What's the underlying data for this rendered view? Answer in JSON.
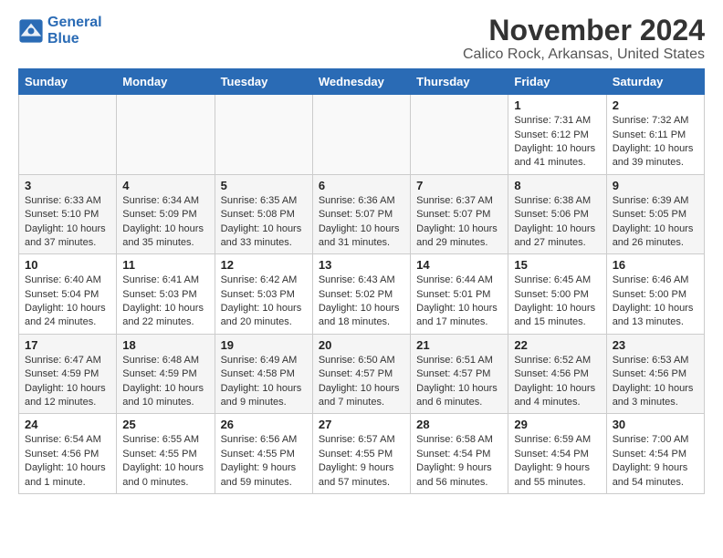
{
  "logo": {
    "line1": "General",
    "line2": "Blue"
  },
  "title": "November 2024",
  "subtitle": "Calico Rock, Arkansas, United States",
  "weekdays": [
    "Sunday",
    "Monday",
    "Tuesday",
    "Wednesday",
    "Thursday",
    "Friday",
    "Saturday"
  ],
  "weeks": [
    [
      {
        "day": "",
        "info": ""
      },
      {
        "day": "",
        "info": ""
      },
      {
        "day": "",
        "info": ""
      },
      {
        "day": "",
        "info": ""
      },
      {
        "day": "",
        "info": ""
      },
      {
        "day": "1",
        "info": "Sunrise: 7:31 AM\nSunset: 6:12 PM\nDaylight: 10 hours and 41 minutes."
      },
      {
        "day": "2",
        "info": "Sunrise: 7:32 AM\nSunset: 6:11 PM\nDaylight: 10 hours and 39 minutes."
      }
    ],
    [
      {
        "day": "3",
        "info": "Sunrise: 6:33 AM\nSunset: 5:10 PM\nDaylight: 10 hours and 37 minutes."
      },
      {
        "day": "4",
        "info": "Sunrise: 6:34 AM\nSunset: 5:09 PM\nDaylight: 10 hours and 35 minutes."
      },
      {
        "day": "5",
        "info": "Sunrise: 6:35 AM\nSunset: 5:08 PM\nDaylight: 10 hours and 33 minutes."
      },
      {
        "day": "6",
        "info": "Sunrise: 6:36 AM\nSunset: 5:07 PM\nDaylight: 10 hours and 31 minutes."
      },
      {
        "day": "7",
        "info": "Sunrise: 6:37 AM\nSunset: 5:07 PM\nDaylight: 10 hours and 29 minutes."
      },
      {
        "day": "8",
        "info": "Sunrise: 6:38 AM\nSunset: 5:06 PM\nDaylight: 10 hours and 27 minutes."
      },
      {
        "day": "9",
        "info": "Sunrise: 6:39 AM\nSunset: 5:05 PM\nDaylight: 10 hours and 26 minutes."
      }
    ],
    [
      {
        "day": "10",
        "info": "Sunrise: 6:40 AM\nSunset: 5:04 PM\nDaylight: 10 hours and 24 minutes."
      },
      {
        "day": "11",
        "info": "Sunrise: 6:41 AM\nSunset: 5:03 PM\nDaylight: 10 hours and 22 minutes."
      },
      {
        "day": "12",
        "info": "Sunrise: 6:42 AM\nSunset: 5:03 PM\nDaylight: 10 hours and 20 minutes."
      },
      {
        "day": "13",
        "info": "Sunrise: 6:43 AM\nSunset: 5:02 PM\nDaylight: 10 hours and 18 minutes."
      },
      {
        "day": "14",
        "info": "Sunrise: 6:44 AM\nSunset: 5:01 PM\nDaylight: 10 hours and 17 minutes."
      },
      {
        "day": "15",
        "info": "Sunrise: 6:45 AM\nSunset: 5:00 PM\nDaylight: 10 hours and 15 minutes."
      },
      {
        "day": "16",
        "info": "Sunrise: 6:46 AM\nSunset: 5:00 PM\nDaylight: 10 hours and 13 minutes."
      }
    ],
    [
      {
        "day": "17",
        "info": "Sunrise: 6:47 AM\nSunset: 4:59 PM\nDaylight: 10 hours and 12 minutes."
      },
      {
        "day": "18",
        "info": "Sunrise: 6:48 AM\nSunset: 4:59 PM\nDaylight: 10 hours and 10 minutes."
      },
      {
        "day": "19",
        "info": "Sunrise: 6:49 AM\nSunset: 4:58 PM\nDaylight: 10 hours and 9 minutes."
      },
      {
        "day": "20",
        "info": "Sunrise: 6:50 AM\nSunset: 4:57 PM\nDaylight: 10 hours and 7 minutes."
      },
      {
        "day": "21",
        "info": "Sunrise: 6:51 AM\nSunset: 4:57 PM\nDaylight: 10 hours and 6 minutes."
      },
      {
        "day": "22",
        "info": "Sunrise: 6:52 AM\nSunset: 4:56 PM\nDaylight: 10 hours and 4 minutes."
      },
      {
        "day": "23",
        "info": "Sunrise: 6:53 AM\nSunset: 4:56 PM\nDaylight: 10 hours and 3 minutes."
      }
    ],
    [
      {
        "day": "24",
        "info": "Sunrise: 6:54 AM\nSunset: 4:56 PM\nDaylight: 10 hours and 1 minute."
      },
      {
        "day": "25",
        "info": "Sunrise: 6:55 AM\nSunset: 4:55 PM\nDaylight: 10 hours and 0 minutes."
      },
      {
        "day": "26",
        "info": "Sunrise: 6:56 AM\nSunset: 4:55 PM\nDaylight: 9 hours and 59 minutes."
      },
      {
        "day": "27",
        "info": "Sunrise: 6:57 AM\nSunset: 4:55 PM\nDaylight: 9 hours and 57 minutes."
      },
      {
        "day": "28",
        "info": "Sunrise: 6:58 AM\nSunset: 4:54 PM\nDaylight: 9 hours and 56 minutes."
      },
      {
        "day": "29",
        "info": "Sunrise: 6:59 AM\nSunset: 4:54 PM\nDaylight: 9 hours and 55 minutes."
      },
      {
        "day": "30",
        "info": "Sunrise: 7:00 AM\nSunset: 4:54 PM\nDaylight: 9 hours and 54 minutes."
      }
    ]
  ]
}
